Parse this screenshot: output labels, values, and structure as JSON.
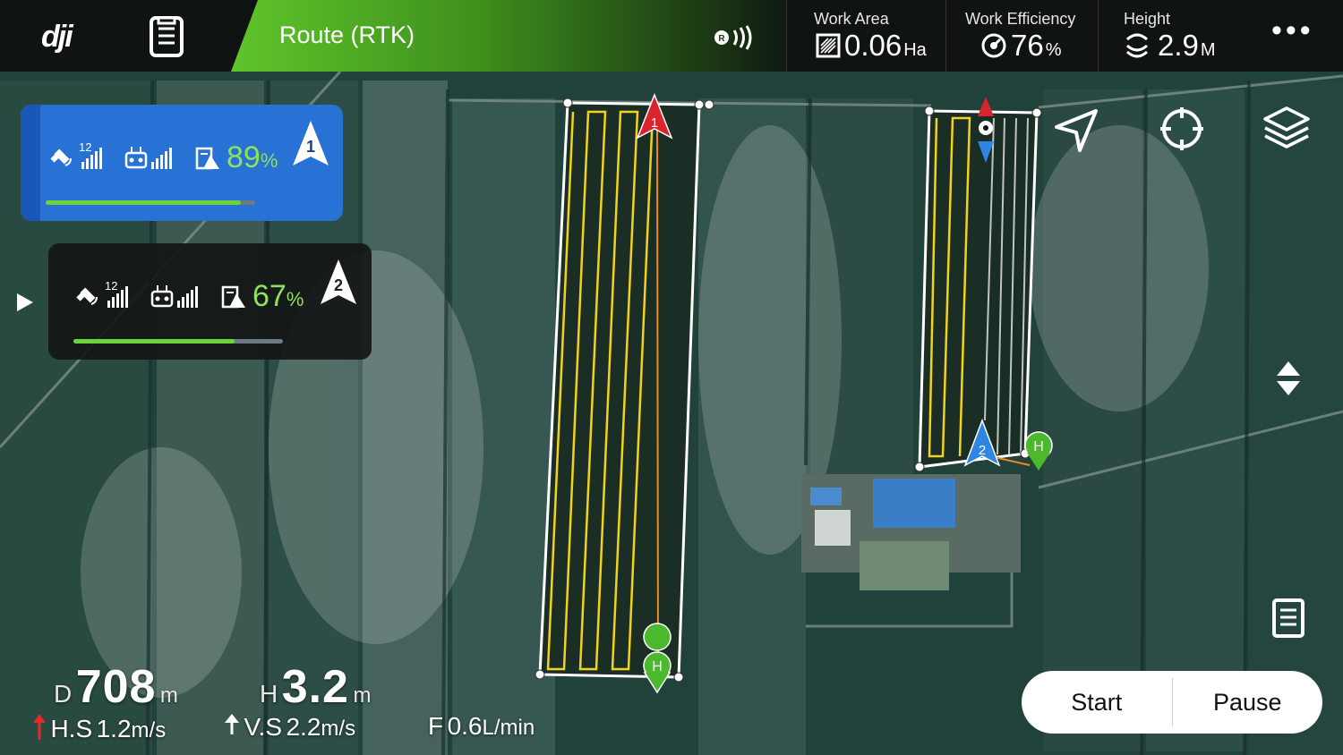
{
  "header": {
    "logo": "dji",
    "route_title": "Route (RTK)",
    "stats": [
      {
        "label": "Work Area",
        "value": "0.06",
        "unit": "Ha",
        "icon": "area-icon"
      },
      {
        "label": "Work Efficiency",
        "value": "76",
        "unit": "%",
        "icon": "efficiency-gauge-icon"
      },
      {
        "label": "Height",
        "value": "2.9",
        "unit": "M",
        "icon": "height-icon"
      }
    ],
    "more": "•••"
  },
  "drones": [
    {
      "sat_count": "12",
      "battery_value": "89",
      "battery_unit": "%",
      "badge": "1",
      "progress": 0.93
    },
    {
      "sat_count": "12",
      "battery_value": "67",
      "battery_unit": "%",
      "badge": "2",
      "progress": 0.77
    }
  ],
  "map": {
    "markers": [
      {
        "label": "1",
        "color": "#d9242e"
      },
      {
        "label": "2",
        "color": "#2f86e0"
      },
      {
        "label": "H",
        "color": "#4cb82e"
      },
      {
        "label": "H",
        "color": "#4cb82e"
      }
    ],
    "route_color": "#f2d21b"
  },
  "telemetry": {
    "d_label": "D",
    "d_value": "708",
    "d_unit": "m",
    "h_label": "H",
    "h_value": "3.2",
    "h_unit": "m",
    "hs_label": "H.S",
    "hs_value": "1.2",
    "hs_unit": "m/s",
    "vs_label": "V.S",
    "vs_value": "2.2",
    "vs_unit": "m/s",
    "f_label": "F",
    "f_value": "0.6",
    "f_unit": "L/min"
  },
  "controls": {
    "start": "Start",
    "pause": "Pause"
  }
}
